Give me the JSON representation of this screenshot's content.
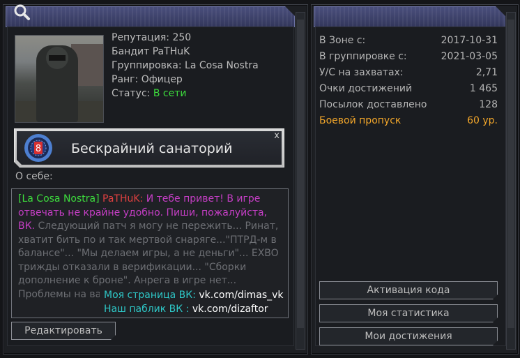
{
  "profile": {
    "reputation": "Репутация: 250",
    "name_line": "Бандит PaTHuK",
    "faction": "Группировка: La Cosa Nostra",
    "rank": "Ранг: Офицер",
    "status_label": "Статус: ",
    "status_value": "В сети"
  },
  "clan": {
    "name": "Бескрайний санаторий",
    "close": "x",
    "emblem_letter": "8"
  },
  "about": {
    "label": "О себе:",
    "tag": "[La Cosa Nostra]",
    "nick": "PaTHuK:",
    "greeting": " И тебе привет! В игре отвечать не крайне удобно. Пиши, пожалуйста, ВК.",
    "body": "Следующий патч я могу не пережить... Ринат, хватит бить по и так мертвой снаряге...\"ПТРД-м в балансе\"... \"Мы делаем игры, а не деньги\"... EXBO трижды отказали в верификации...  \"Сборки дополнение к броне\". Анрега в игре нет... Проблемы на вашей стороне.",
    "link1_label": "Моя страница ВК:",
    "link1_value": "vk.com/dimas_vk",
    "link2_label": "Наш паблик ВК  :",
    "link2_value": "vk.com/dizaftor"
  },
  "buttons": {
    "edit": "Редактировать",
    "activate": "Активация кода",
    "stats": "Моя статистика",
    "achievements": "Мои достижения"
  },
  "stats": [
    {
      "label": "В Зоне с:",
      "value": "2017-10-31"
    },
    {
      "label": "В группировке с:",
      "value": "2021-03-05"
    },
    {
      "label": "У/С на захватах:",
      "value": "2,71"
    },
    {
      "label": "Очки достижений",
      "value": "1 465"
    },
    {
      "label": "Посылок доставлено",
      "value": "128"
    },
    {
      "label": "Боевой пропуск",
      "value": "60 ур."
    }
  ],
  "icons": {
    "search": "search-icon",
    "emblem": "clan-emblem-icon"
  },
  "colors": {
    "online": "#3ddc3d",
    "highlight": "#f2a62a",
    "header": "#3f4470",
    "link": "#2ec7c7"
  }
}
